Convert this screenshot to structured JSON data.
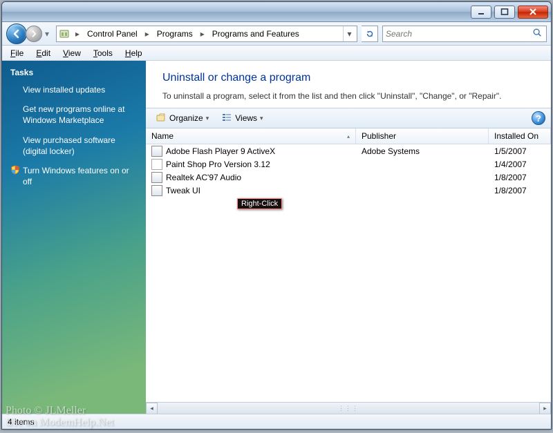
{
  "breadcrumbs": [
    "Control Panel",
    "Programs",
    "Programs and Features"
  ],
  "search": {
    "placeholder": "Search"
  },
  "menus": [
    {
      "label": "File",
      "accel": "F"
    },
    {
      "label": "Edit",
      "accel": "E"
    },
    {
      "label": "View",
      "accel": "V"
    },
    {
      "label": "Tools",
      "accel": "T"
    },
    {
      "label": "Help",
      "accel": "H"
    }
  ],
  "tasks": {
    "heading": "Tasks",
    "items": [
      {
        "label": "View installed updates",
        "icon": ""
      },
      {
        "label": "Get new programs online at Windows Marketplace",
        "icon": ""
      },
      {
        "label": "View purchased software (digital locker)",
        "icon": ""
      },
      {
        "label": "Turn Windows features on or off",
        "icon": "shield"
      }
    ]
  },
  "main": {
    "title": "Uninstall or change a program",
    "subtitle": "To uninstall a program, select it from the list and then click \"Uninstall\", \"Change\", or \"Repair\"."
  },
  "toolbar": {
    "organize": "Organize",
    "views": "Views"
  },
  "columns": {
    "name": "Name",
    "publisher": "Publisher",
    "installed": "Installed On"
  },
  "rows": [
    {
      "name": "Adobe Flash Player 9 ActiveX",
      "publisher": "Adobe Systems",
      "installed": "1/5/2007",
      "icon": "generic"
    },
    {
      "name": "Paint Shop Pro Version 3.12",
      "publisher": "",
      "installed": "1/4/2007",
      "icon": "sheet"
    },
    {
      "name": "Realtek AC'97 Audio",
      "publisher": "",
      "installed": "1/8/2007",
      "icon": "generic"
    },
    {
      "name": "Tweak UI",
      "publisher": "",
      "installed": "1/8/2007",
      "icon": "generic"
    }
  ],
  "tooltip": "Right-Click",
  "status": "4 items",
  "watermark": {
    "line1": "Photo © JLMeller",
    "line2": "Use on ModemHelp.Net"
  }
}
